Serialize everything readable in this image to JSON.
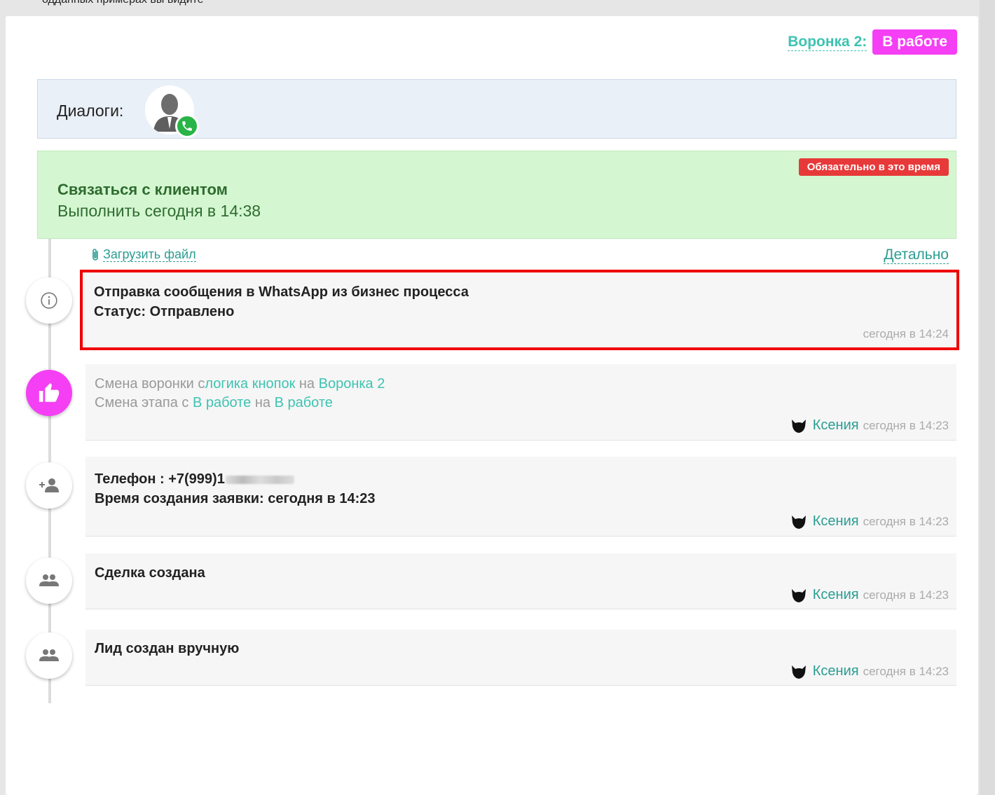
{
  "top_cut_text": "одданных примерах вы видите",
  "funnel": {
    "label": "Воронка 2:",
    "stage": "В работе"
  },
  "dialogs": {
    "label": "Диалоги:"
  },
  "task": {
    "badge": "Обязательно в это время",
    "title": "Связаться с клиентом",
    "due": "Выполнить сегодня в 14:38"
  },
  "actions": {
    "upload": "Загрузить файл",
    "detail": "Детально"
  },
  "events": [
    {
      "icon": "info-icon",
      "line1": "Отправка сообщения в WhatsApp из бизнес процесса",
      "line2": "Статус: Отправлено",
      "time": "сегодня в 14:24"
    },
    {
      "icon": "thumbs-up-icon",
      "line1_prefix": "Смена воронки с",
      "line1_from": "логика кнопок",
      "line1_mid": " на ",
      "line1_to": "Воронка 2",
      "line2_prefix": "Смена этапа с ",
      "line2_from": "В работе",
      "line2_mid": " на ",
      "line2_to": "В работе",
      "user": "Ксения",
      "time": "сегодня в 14:23"
    },
    {
      "icon": "add-person-icon",
      "line1": "Телефон : +7(999)1",
      "line2": "Время создания заявки: сегодня в 14:23",
      "user": "Ксения",
      "time": "сегодня в 14:23"
    },
    {
      "icon": "people-icon",
      "line1": "Сделка создана",
      "user": "Ксения",
      "time": "сегодня в 14:23"
    },
    {
      "icon": "people-icon",
      "line1": "Лид создан вручную",
      "user": "Ксения",
      "time": "сегодня в 14:23"
    }
  ],
  "colors": {
    "accent_teal": "#3ec3b2",
    "stage_pink": "#f43ff4",
    "task_green": "#d4f7d1",
    "badge_red": "#e8393a",
    "highlight_red": "#ef0000"
  }
}
